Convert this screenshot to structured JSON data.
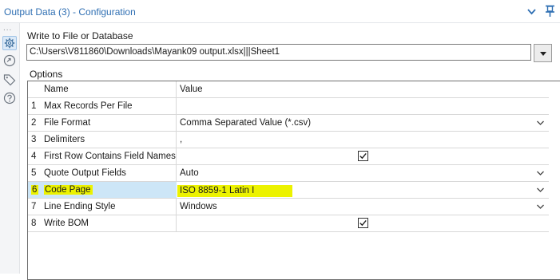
{
  "window": {
    "title": "Output Data (3) - Configuration",
    "collapse_icon": "chevron-down-icon",
    "pin_icon": "pin-icon"
  },
  "rail": {
    "dots": "...",
    "icons": [
      "gear-icon",
      "rotate-arrow-icon",
      "tag-icon",
      "help-icon"
    ]
  },
  "write_to": {
    "label": "Write to File or Database",
    "value": "C:\\Users\\V811860\\Downloads\\Mayank09 output.xlsx|||Sheet1"
  },
  "options": {
    "label": "Options",
    "columns": {
      "name": "Name",
      "value": "Value"
    },
    "rows": [
      {
        "num": "1",
        "name": "Max Records Per File",
        "value": "",
        "kind": "text"
      },
      {
        "num": "2",
        "name": "File Format",
        "value": "Comma Separated Value (*.csv)",
        "kind": "dropdown"
      },
      {
        "num": "3",
        "name": "Delimiters",
        "value": ",",
        "kind": "text"
      },
      {
        "num": "4",
        "name": "First Row Contains Field Names",
        "value": "",
        "kind": "checkbox",
        "checked": true
      },
      {
        "num": "5",
        "name": "Quote Output Fields",
        "value": "Auto",
        "kind": "dropdown"
      },
      {
        "num": "6",
        "name": "Code Page",
        "value": "ISO 8859-1 Latin I",
        "kind": "dropdown",
        "selected": true,
        "highlight": "#ecf200"
      },
      {
        "num": "7",
        "name": "Line Ending Style",
        "value": "Windows",
        "kind": "dropdown"
      },
      {
        "num": "8",
        "name": "Write BOM",
        "value": "",
        "kind": "checkbox",
        "checked": true
      }
    ]
  },
  "colors": {
    "title": "#2f6fb3",
    "selected_row": "#cde6f7",
    "highlight": "#ecf200"
  }
}
